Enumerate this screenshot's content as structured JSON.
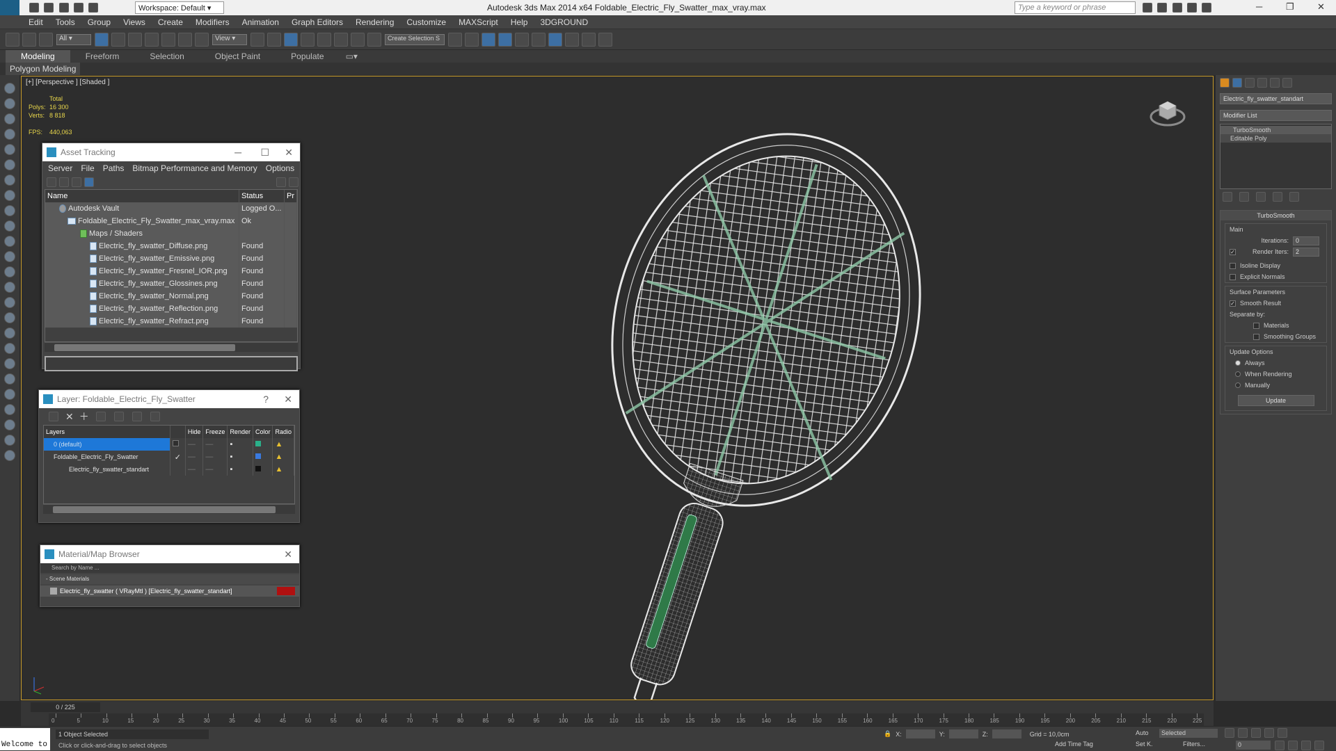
{
  "titlebar": {
    "workspace": "Workspace: Default",
    "app_title": "Autodesk 3ds Max  2014 x64      Foldable_Electric_Fly_Swatter_max_vray.max",
    "search_placeholder": "Type a keyword or phrase"
  },
  "menu": [
    "Edit",
    "Tools",
    "Group",
    "Views",
    "Create",
    "Modifiers",
    "Animation",
    "Graph Editors",
    "Rendering",
    "Customize",
    "MAXScript",
    "Help",
    "3DGROUND"
  ],
  "toolbar": {
    "filter": "All",
    "refcoord": "View",
    "selset": "Create Selection S"
  },
  "ribbon": {
    "tabs": [
      "Modeling",
      "Freeform",
      "Selection",
      "Object Paint",
      "Populate"
    ],
    "sub": "Polygon Modeling"
  },
  "viewport": {
    "label": "[+] [Perspective ] [Shaded ]",
    "stats": {
      "total": "Total",
      "polys_label": "Polys:",
      "polys": "16 300",
      "verts_label": "Verts:",
      "verts": "8 818",
      "fps_label": "FPS:",
      "fps": "440,063"
    }
  },
  "asset_tracking": {
    "title": "Asset Tracking",
    "menu": [
      "Server",
      "File",
      "Paths",
      "Bitmap Performance and Memory",
      "Options"
    ],
    "columns": [
      "Name",
      "Status",
      "Pr"
    ],
    "rows": [
      {
        "name": "Autodesk Vault",
        "status": "Logged O..."
      },
      {
        "name": "Foldable_Electric_Fly_Swatter_max_vray.max",
        "status": "Ok"
      },
      {
        "name": "Maps / Shaders",
        "status": ""
      },
      {
        "name": "Electric_fly_swatter_Diffuse.png",
        "status": "Found"
      },
      {
        "name": "Electric_fly_swatter_Emissive.png",
        "status": "Found"
      },
      {
        "name": "Electric_fly_swatter_Fresnel_IOR.png",
        "status": "Found"
      },
      {
        "name": "Electric_fly_swatter_Glossines.png",
        "status": "Found"
      },
      {
        "name": "Electric_fly_swatter_Normal.png",
        "status": "Found"
      },
      {
        "name": "Electric_fly_swatter_Reflection.png",
        "status": "Found"
      },
      {
        "name": "Electric_fly_swatter_Refract.png",
        "status": "Found"
      }
    ]
  },
  "layer_panel": {
    "title": "Layer: Foldable_Electric_Fly_Swatter",
    "columns": [
      "Layers",
      "Hide",
      "Freeze",
      "Render",
      "Color",
      "Radio"
    ],
    "rows": [
      {
        "name": "0 (default)"
      },
      {
        "name": "Foldable_Electric_Fly_Swatter"
      },
      {
        "name": "Electric_fly_swatter_standart"
      }
    ]
  },
  "material_browser": {
    "title": "Material/Map Browser",
    "search_placeholder": "Search by Name ...",
    "group": "- Scene Materials",
    "item": "Electric_fly_swatter ( VRayMtl ) [Electric_fly_swatter_standart]"
  },
  "command_panel": {
    "object_name": "Electric_fly_swatter_standart",
    "modifier_list": "Modifier List",
    "stack": [
      "TurboSmooth",
      "Editable Poly"
    ],
    "turbosmooth": {
      "title": "TurboSmooth",
      "main": "Main",
      "iterations_label": "Iterations:",
      "iterations": "0",
      "render_iters_label": "Render Iters:",
      "render_iters": "2",
      "isoline": "Isoline Display",
      "explicit": "Explicit Normals",
      "surface_params": "Surface Parameters",
      "smooth_result": "Smooth Result",
      "separate_by": "Separate by:",
      "materials": "Materials",
      "smoothing_groups": "Smoothing Groups",
      "update_options": "Update Options",
      "always": "Always",
      "when_rendering": "When Rendering",
      "manually": "Manually",
      "update_btn": "Update"
    }
  },
  "timeline": {
    "frame": "0 / 225",
    "ticks": [
      "0",
      "5",
      "10",
      "15",
      "20",
      "25",
      "30",
      "35",
      "40",
      "45",
      "50",
      "55",
      "60",
      "65",
      "70",
      "75",
      "80",
      "85",
      "90",
      "95",
      "100",
      "105",
      "110",
      "115",
      "120",
      "125",
      "130",
      "135",
      "140",
      "145",
      "150",
      "155",
      "160",
      "165",
      "170",
      "175",
      "180",
      "185",
      "190",
      "195",
      "200",
      "205",
      "210",
      "215",
      "220",
      "225"
    ]
  },
  "status": {
    "welcome": "Welcome to",
    "selected": "1 Object Selected",
    "hint": "Click or click-and-drag to select objects",
    "x": "X:",
    "y": "Y:",
    "z": "Z:",
    "grid": "Grid = 10,0cm",
    "add_time_tag": "Add Time Tag",
    "auto": "Auto",
    "setk": "Set K.",
    "selected_dd": "Selected",
    "filters": "Filters...",
    "frame_input": "0"
  }
}
